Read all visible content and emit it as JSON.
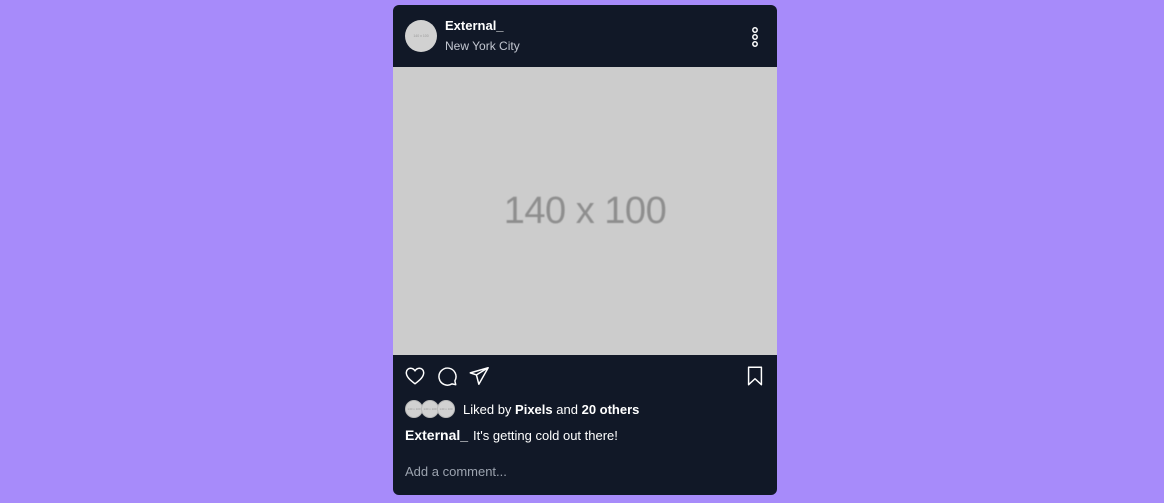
{
  "post": {
    "username": "External_",
    "location": "New York City",
    "avatar_text": "140 x 100",
    "image_placeholder": "140 x 100",
    "liked_by_prefix": "Liked by",
    "liked_by_user": "Pixels",
    "liked_by_and": "and",
    "liked_by_others": "20 others",
    "caption_user": "External_",
    "caption_text": "It's getting cold out there!",
    "comment_placeholder": "Add a comment..."
  },
  "icons": {
    "more": "more-vertical-icon",
    "like": "heart-icon",
    "comment": "comment-icon",
    "share": "send-icon",
    "save": "bookmark-icon"
  },
  "colors": {
    "background": "#a78bfa",
    "card": "#111827",
    "image_bg": "#cccccc",
    "muted_text": "#9ca3af"
  }
}
